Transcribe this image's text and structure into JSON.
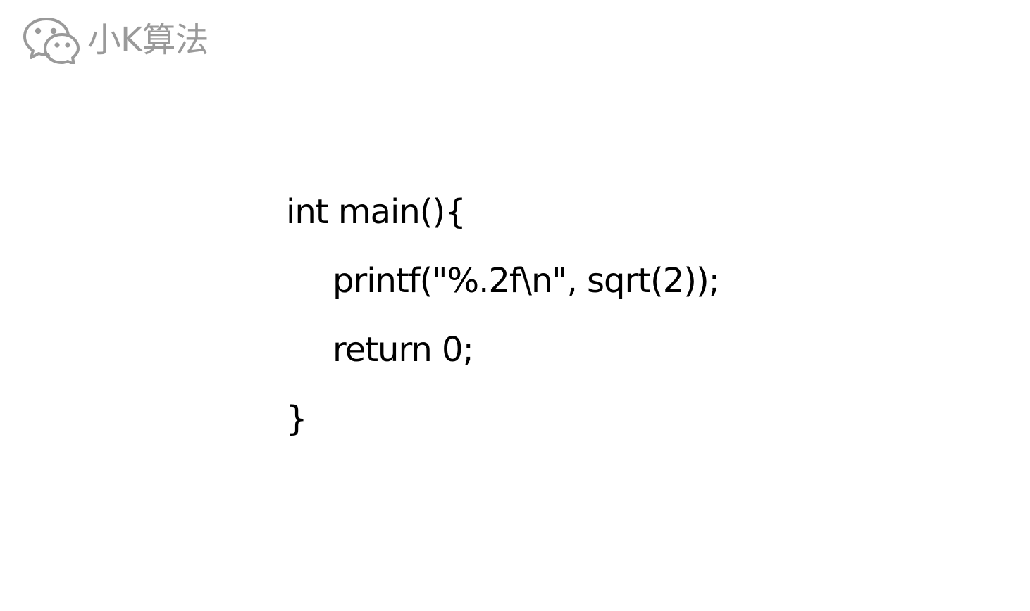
{
  "watermark": {
    "icon": "wechat-icon",
    "icon_color": "#9a9a9a",
    "name": "小K算法"
  },
  "code": {
    "lines": [
      "int main(){",
      "printf(\"%.2f\\n\", sqrt(2));",
      "return 0;",
      "}"
    ]
  }
}
